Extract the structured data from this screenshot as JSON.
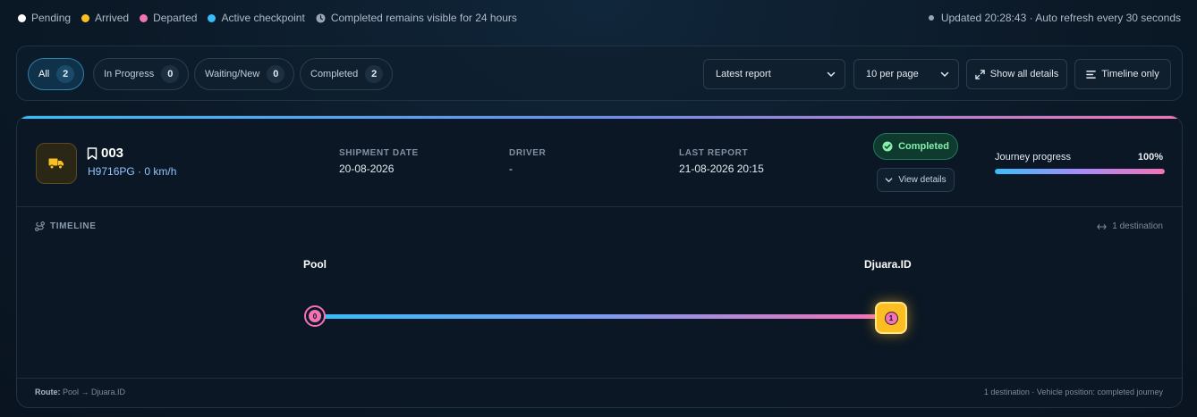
{
  "legend": {
    "items": [
      {
        "label": "Pending",
        "color": "#ffffff"
      },
      {
        "label": "Arrived",
        "color": "#fbbf24"
      },
      {
        "label": "Departed",
        "color": "#f472b6"
      },
      {
        "label": "Active checkpoint",
        "color": "#38bdf8"
      }
    ],
    "note": "Completed remains visible for 24 hours",
    "note_icon": "clock-icon",
    "updated": "Updated 20:28:43 · Auto refresh every 30 seconds"
  },
  "filters": {
    "tabs": [
      {
        "label": "All",
        "count": "2",
        "active": true
      },
      {
        "label": "In Progress",
        "count": "0"
      },
      {
        "label": "Waiting/New",
        "count": "0"
      },
      {
        "label": "Completed",
        "count": "2"
      }
    ],
    "sort_select": "Latest report",
    "per_page_select": "10 per page",
    "show_all_details": "Show all details",
    "timeline_only": "Timeline only"
  },
  "card": {
    "vehicle_icon": "truck-icon",
    "vehicle_id": "003",
    "vehicle_sub": "H9716PG · 0 km/h",
    "shipment_date_label": "SHIPMENT DATE",
    "shipment_date": "20-08-2026",
    "driver_label": "DRIVER",
    "driver": "-",
    "last_report_label": "LAST REPORT",
    "last_report": "21-08-2026 20:15",
    "status": "Completed",
    "view_details": "View details",
    "progress_label": "Journey progress",
    "progress_text": "100%",
    "progress_value": 100,
    "timeline_title": "TIMELINE",
    "destination_count": "1 destination",
    "stops": [
      {
        "name": "Pool",
        "index": "0"
      },
      {
        "name": "Djuara.ID",
        "index": "1"
      }
    ],
    "route_label": "Route:",
    "route_value": "Pool → Djuara.ID",
    "footer_right": "1 destination · Vehicle position: completed journey"
  },
  "colors": {
    "accent_blue": "#38bdf8",
    "accent_pink": "#f472b6",
    "arrived_yellow": "#fbbf24",
    "completed_green": "#86efac"
  }
}
